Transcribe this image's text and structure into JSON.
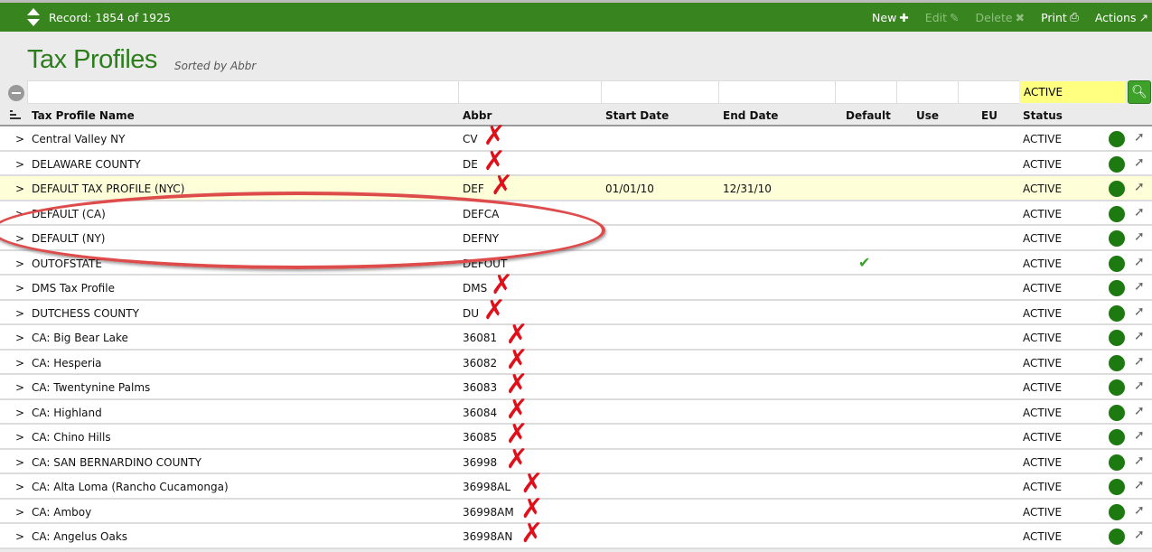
{
  "topbar": {
    "record": "Record: 1854 of 1925",
    "actions": [
      {
        "label": "New",
        "icon": "plus",
        "enabled": true
      },
      {
        "label": "Edit",
        "icon": "pencil",
        "enabled": false
      },
      {
        "label": "Delete",
        "icon": "x",
        "enabled": false
      },
      {
        "label": "Print",
        "icon": "printer",
        "enabled": true
      },
      {
        "label": "Actions",
        "icon": "arrow-up-right",
        "enabled": true
      }
    ]
  },
  "page": {
    "title": "Tax Profiles",
    "subtitle": "Sorted by Abbr"
  },
  "filter": {
    "status_value": "ACTIVE"
  },
  "columns": [
    "Tax Profile Name",
    "Abbr",
    "Start Date",
    "End Date",
    "Default",
    "Use",
    "EU",
    "Status"
  ],
  "colors": {
    "accent": "#38841f",
    "status_active": "#1d7a10",
    "annotation": "#e0101a",
    "highlight": "#fefed8"
  },
  "rows": [
    {
      "name": "Central Valley NY",
      "abbr": "CV",
      "start": "",
      "end": "",
      "default": false,
      "status": "ACTIVE",
      "crossed": true
    },
    {
      "name": "DELAWARE COUNTY",
      "abbr": "DE",
      "start": "",
      "end": "",
      "default": false,
      "status": "ACTIVE",
      "crossed": true
    },
    {
      "name": "DEFAULT TAX PROFILE (NYC)",
      "abbr": "DEF",
      "start": "01/01/10",
      "end": "12/31/10",
      "default": false,
      "status": "ACTIVE",
      "crossed": true,
      "highlighted": true
    },
    {
      "name": "DEFAULT (CA)",
      "abbr": "DEFCA",
      "start": "",
      "end": "",
      "default": false,
      "status": "ACTIVE",
      "crossed": false
    },
    {
      "name": "DEFAULT (NY)",
      "abbr": "DEFNY",
      "start": "",
      "end": "",
      "default": false,
      "status": "ACTIVE",
      "crossed": false
    },
    {
      "name": "OUTOFSTATE",
      "abbr": "DEFOUT",
      "start": "",
      "end": "",
      "default": true,
      "status": "ACTIVE",
      "crossed": false
    },
    {
      "name": "DMS Tax Profile",
      "abbr": "DMS",
      "start": "",
      "end": "",
      "default": false,
      "status": "ACTIVE",
      "crossed": true
    },
    {
      "name": "DUTCHESS COUNTY",
      "abbr": "DU",
      "start": "",
      "end": "",
      "default": false,
      "status": "ACTIVE",
      "crossed": true
    },
    {
      "name": "CA: Big Bear Lake",
      "abbr": "36081",
      "start": "",
      "end": "",
      "default": false,
      "status": "ACTIVE",
      "crossed": true
    },
    {
      "name": "CA: Hesperia",
      "abbr": "36082",
      "start": "",
      "end": "",
      "default": false,
      "status": "ACTIVE",
      "crossed": true
    },
    {
      "name": "CA: Twentynine Palms",
      "abbr": "36083",
      "start": "",
      "end": "",
      "default": false,
      "status": "ACTIVE",
      "crossed": true
    },
    {
      "name": "CA: Highland",
      "abbr": "36084",
      "start": "",
      "end": "",
      "default": false,
      "status": "ACTIVE",
      "crossed": true
    },
    {
      "name": "CA: Chino Hills",
      "abbr": "36085",
      "start": "",
      "end": "",
      "default": false,
      "status": "ACTIVE",
      "crossed": true
    },
    {
      "name": "CA: SAN BERNARDINO COUNTY",
      "abbr": "36998",
      "start": "",
      "end": "",
      "default": false,
      "status": "ACTIVE",
      "crossed": true
    },
    {
      "name": "CA: Alta Loma (Rancho Cucamonga)",
      "abbr": "36998AL",
      "start": "",
      "end": "",
      "default": false,
      "status": "ACTIVE",
      "crossed": true
    },
    {
      "name": "CA: Amboy",
      "abbr": "36998AM",
      "start": "",
      "end": "",
      "default": false,
      "status": "ACTIVE",
      "crossed": true
    },
    {
      "name": "CA: Angelus Oaks",
      "abbr": "36998AN",
      "start": "",
      "end": "",
      "default": false,
      "status": "ACTIVE",
      "crossed": true
    }
  ]
}
